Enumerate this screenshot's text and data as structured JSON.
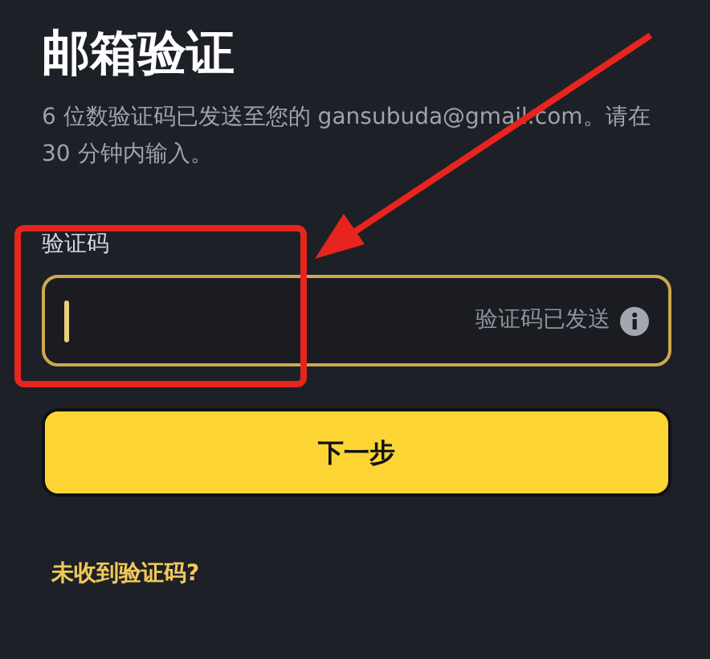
{
  "title": "邮箱验证",
  "description": "6 位数验证码已发送至您的 gansubuda@gmail.com。请在 30 分钟内输入。",
  "code_field": {
    "label": "验证码",
    "focused": true,
    "hint": "验证码已发送"
  },
  "next_button": "下一步",
  "resend_link": "未收到验证码?"
}
